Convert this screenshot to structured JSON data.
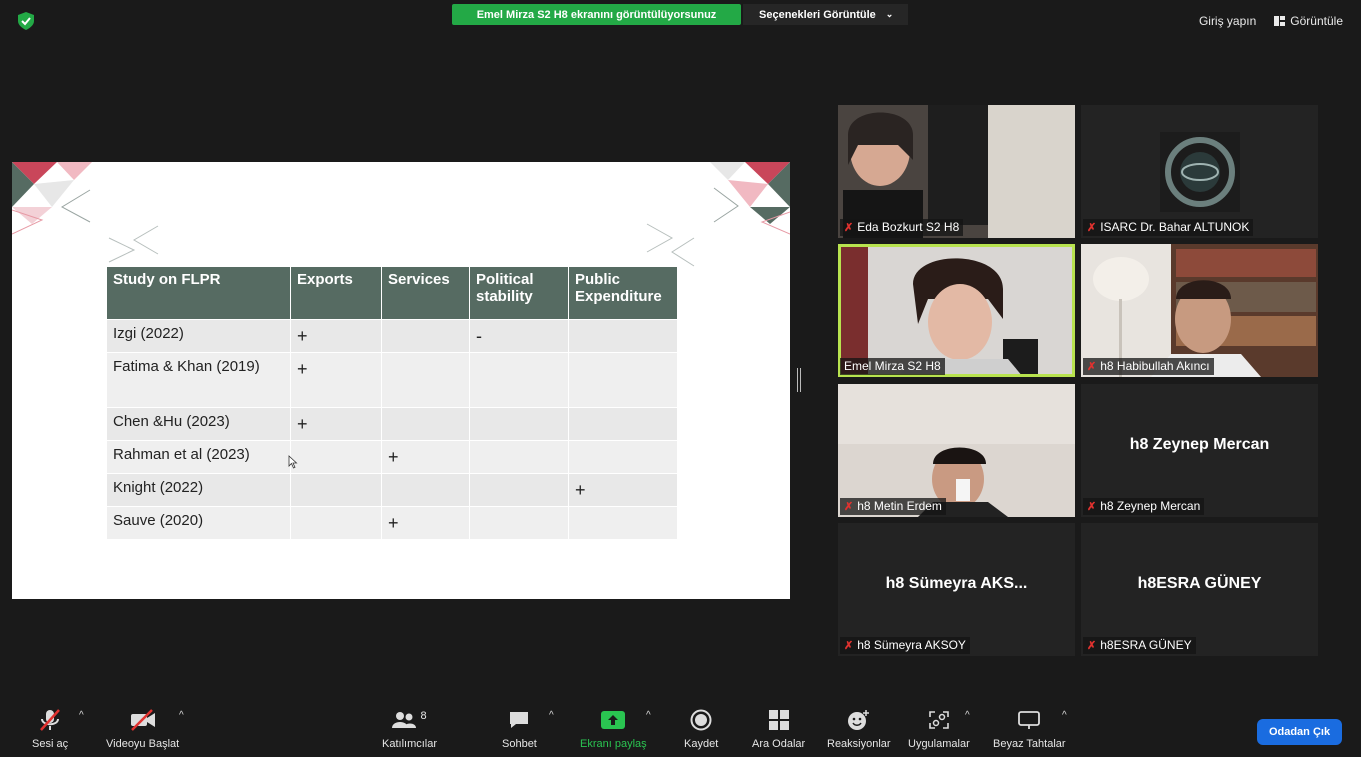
{
  "banner": {
    "sharing_text": "Emel Mirza S2 H8 ekranını görüntülüyorsunuz",
    "view_options": "Seçenekleri Görüntüle"
  },
  "topbar": {
    "signin": "Giriş yapın",
    "view": "Görüntüle"
  },
  "slide": {
    "headers": [
      "Study on FLPR",
      "Exports",
      "Services",
      "Political stability",
      "Public Expenditure"
    ],
    "rows": [
      [
        "Izgi (2022)",
        "+",
        "",
        "-",
        ""
      ],
      [
        "Fatima & Khan (2019)",
        "+",
        "",
        "",
        ""
      ],
      [
        "Chen &Hu (2023)",
        "+",
        "",
        "",
        ""
      ],
      [
        "Rahman et al (2023)",
        "",
        "+",
        "",
        ""
      ],
      [
        "Knight (2022)",
        "",
        "",
        "",
        "+"
      ],
      [
        "Sauve (2020)",
        "",
        "+",
        "",
        ""
      ]
    ]
  },
  "participants": [
    {
      "label": "Eda Bozkurt S2 H8",
      "muted": true
    },
    {
      "label": "ISARC Dr. Bahar ALTUNOK",
      "muted": true
    },
    {
      "label": "Emel Mirza S2 H8",
      "muted": false
    },
    {
      "label": "h8 Habibullah Akıncı",
      "muted": true
    },
    {
      "label": "h8 Metin Erdem",
      "muted": true
    },
    {
      "label": "h8 Zeynep Mercan",
      "muted": true,
      "big": "h8 Zeynep Mercan"
    },
    {
      "label": "h8 Sümeyra AKSOY",
      "muted": true,
      "big": "h8 Sümeyra AKS..."
    },
    {
      "label": "h8ESRA GÜNEY",
      "muted": true,
      "big": "h8ESRA GÜNEY"
    }
  ],
  "toolbar": {
    "unmute": "Sesi aç",
    "start_video": "Videoyu Başlat",
    "participants": "Katılımcılar",
    "participants_count": "8",
    "chat": "Sohbet",
    "share": "Ekranı paylaş",
    "record": "Kaydet",
    "breakout": "Ara Odalar",
    "reactions": "Reaksiyonlar",
    "apps": "Uygulamalar",
    "whiteboard": "Beyaz Tahtalar",
    "leave": "Odadan Çık"
  },
  "colors": {
    "share_green": "#23a946",
    "active_border": "#b8e34f",
    "table_header": "#566b62",
    "leave_blue": "#1a6ce0",
    "muted_red": "#e0322f"
  }
}
